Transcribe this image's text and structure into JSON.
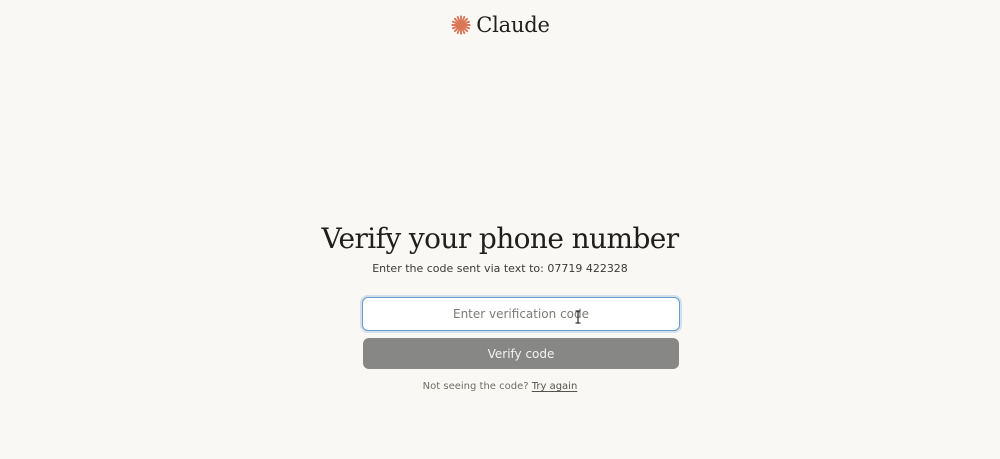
{
  "brand": {
    "name": "Claude",
    "logo_icon": "claude-starburst-icon",
    "accent_color": "#d97757"
  },
  "page": {
    "title": "Verify your phone number",
    "subtitle_prefix": "Enter the code sent via text to:",
    "phone_number": "07719 422328"
  },
  "form": {
    "code_input": {
      "value": "",
      "placeholder": "Enter verification code"
    },
    "verify_button_label": "Verify code",
    "verify_button_color": "#878786"
  },
  "resend": {
    "prompt": "Not seeing the code?",
    "link_label": "Try again"
  }
}
